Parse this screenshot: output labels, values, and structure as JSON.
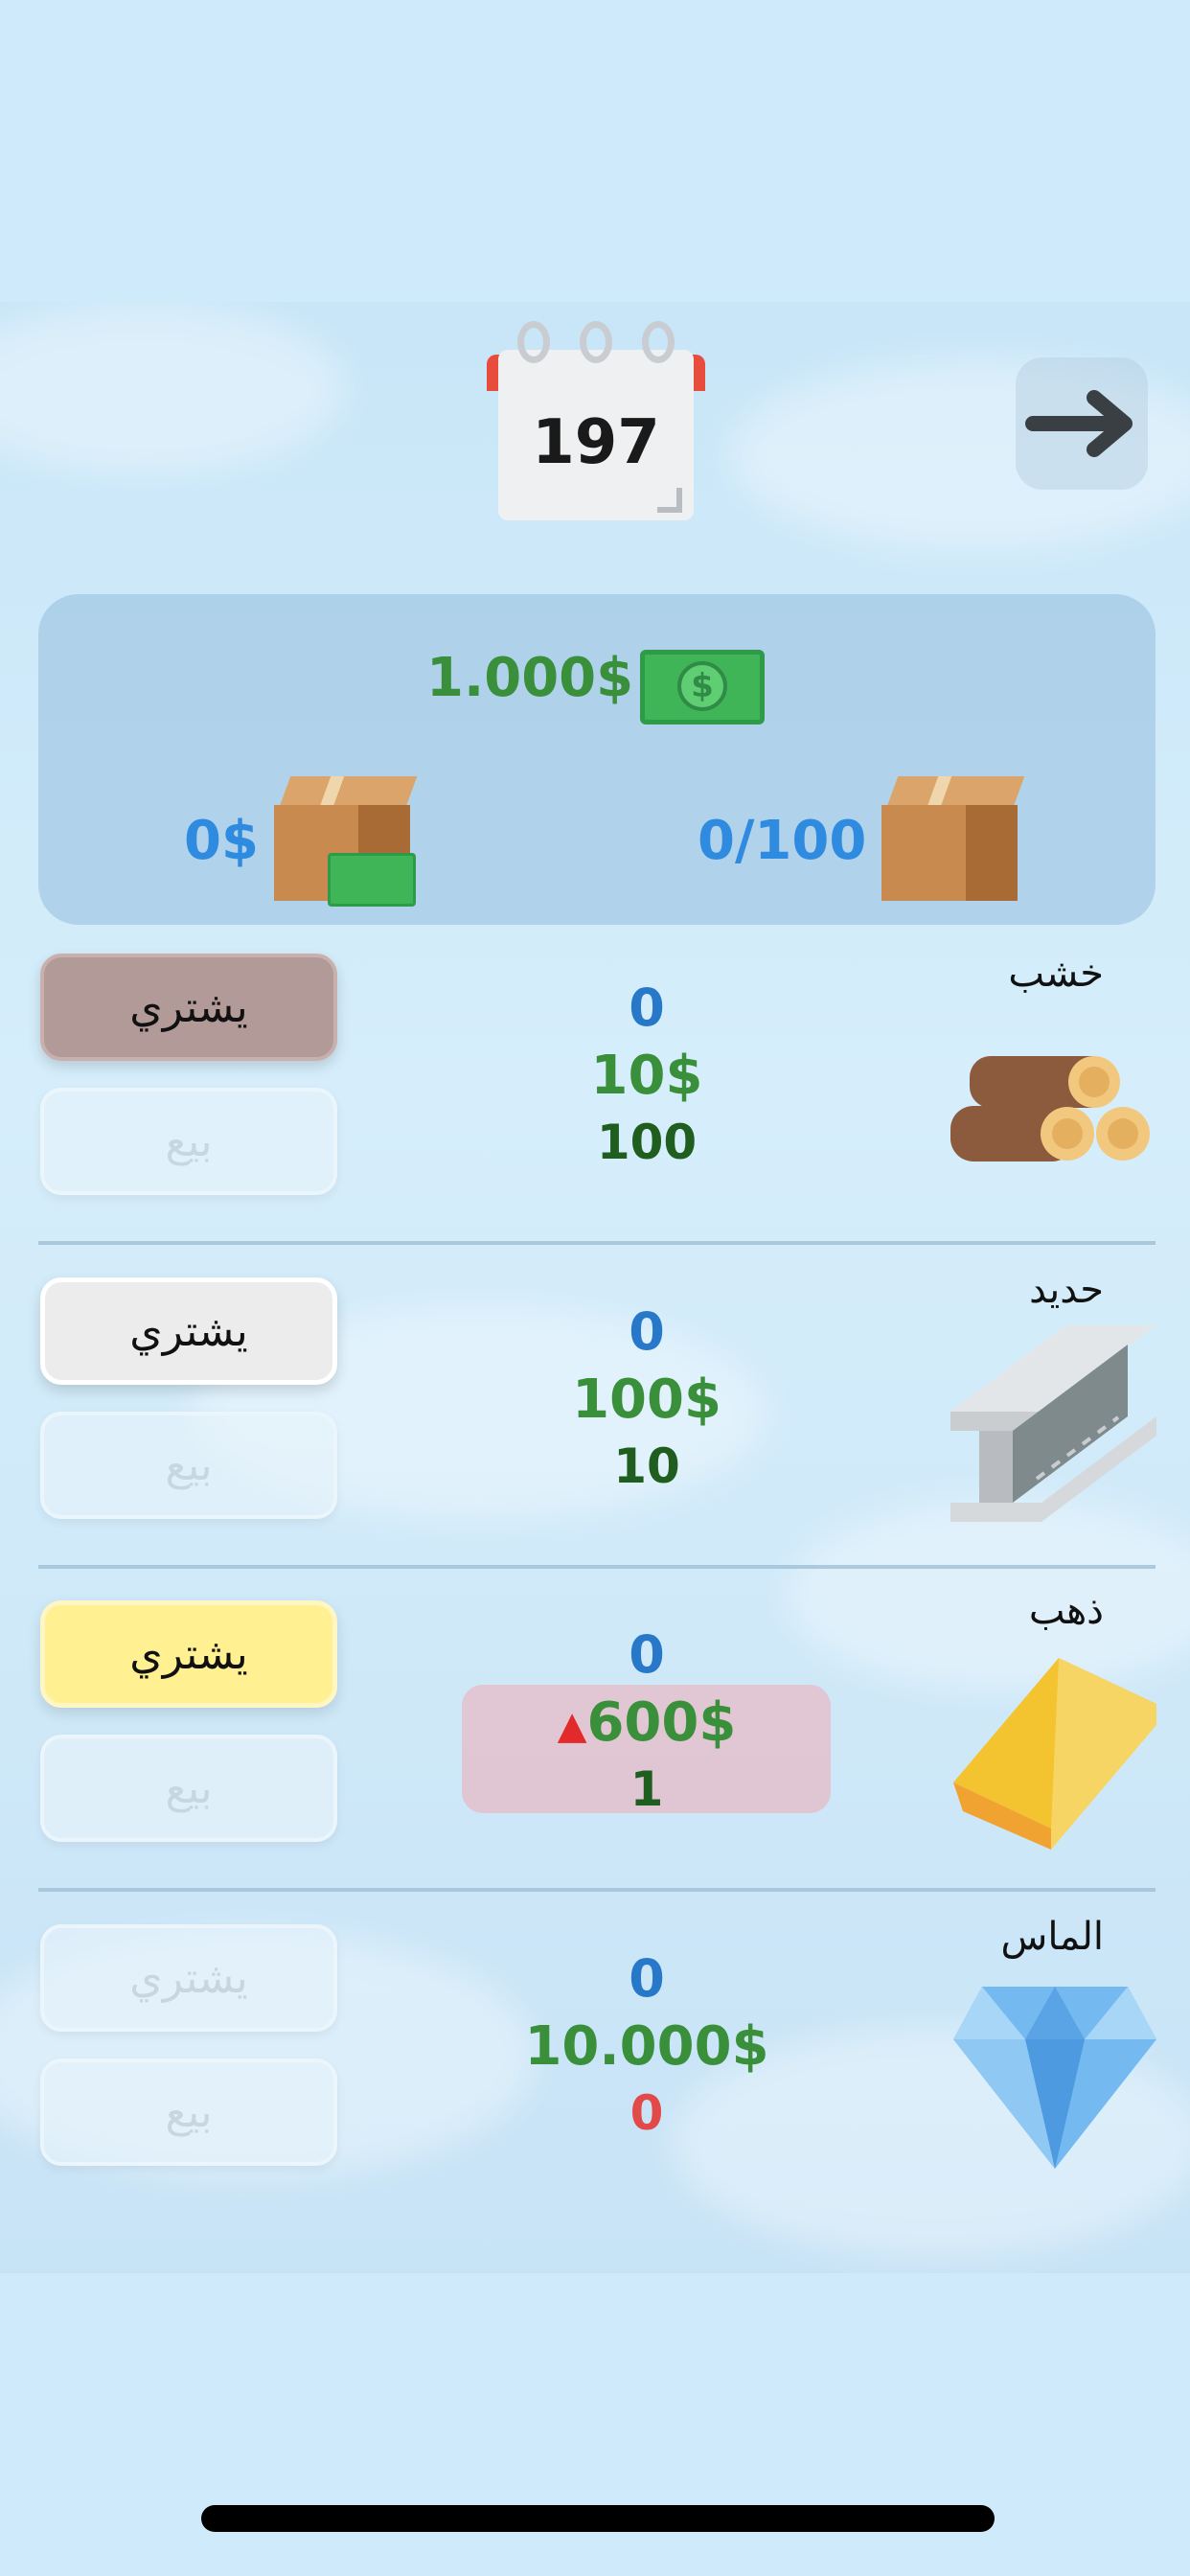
{
  "calendar": {
    "day": "197"
  },
  "stats": {
    "money": "1.000$",
    "bill_symbol": "$",
    "storage_value": "0$",
    "storage_capacity": "0/100"
  },
  "resources": [
    {
      "name": "خشب",
      "owned": "0",
      "price": "10$",
      "stock": "100",
      "buy_label": "يشتري",
      "sell_label": "بيع",
      "icon": "wood-logs-icon"
    },
    {
      "name": "حديد",
      "owned": "0",
      "price": "100$",
      "stock": "10",
      "buy_label": "يشتري",
      "sell_label": "بيع",
      "icon": "iron-beam-icon"
    },
    {
      "name": "ذهب",
      "owned": "0",
      "price": "600$",
      "stock": "1",
      "buy_label": "يشتري",
      "sell_label": "بيع",
      "icon": "gold-bar-icon",
      "trend": "up"
    },
    {
      "name": "الماس",
      "owned": "0",
      "price": "10.000$",
      "stock": "0",
      "buy_label": "يشتري",
      "sell_label": "بيع",
      "icon": "diamond-icon"
    }
  ],
  "colors": {
    "money": "#3a8f3a",
    "owned": "#2878c9",
    "stock_zero": "#e24a4a",
    "accent_red": "#e74c3c"
  }
}
